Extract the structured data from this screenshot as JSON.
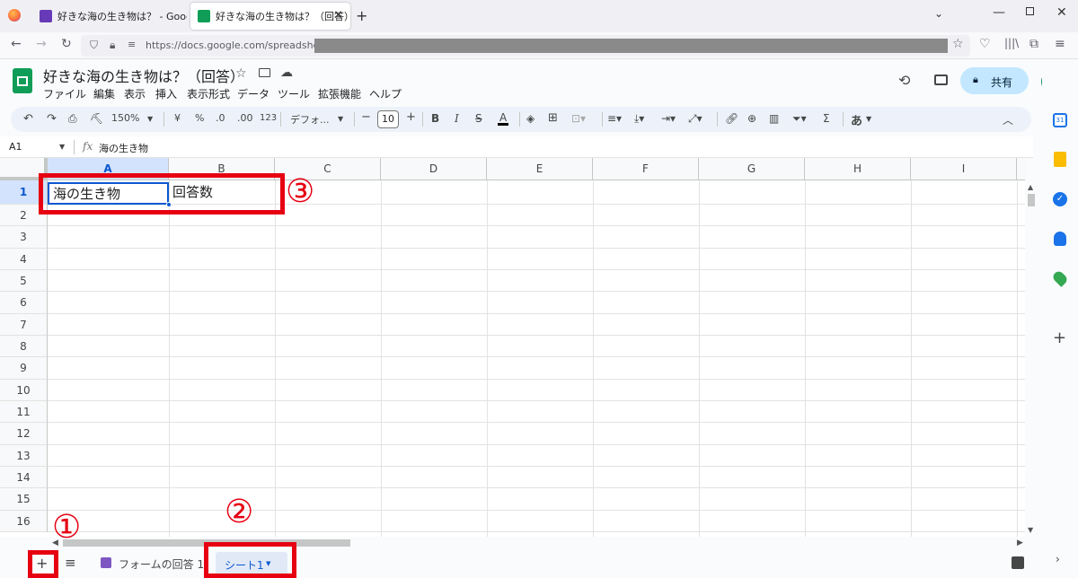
{
  "browser": {
    "tabs": [
      {
        "title": "好きな海の生き物は？ - Google フ",
        "active": false
      },
      {
        "title": "好きな海の生き物は？（回答） - Go",
        "active": true
      }
    ],
    "url_visible": "https://docs.google.com/spreadsheets/"
  },
  "doc": {
    "title": "好きな海の生き物は？（回答）",
    "menu": [
      "ファイル",
      "編集",
      "表示",
      "挿入",
      "表示形式",
      "データ",
      "ツール",
      "拡張機能",
      "ヘルプ"
    ],
    "share_label": "共有"
  },
  "toolbar": {
    "zoom": "150%",
    "currency": "¥",
    "percent": "%",
    "dec_decrease": ".0",
    "dec_increase": ".00",
    "format_123": "123",
    "font": "デフォ...",
    "font_size": "10",
    "bold": "B",
    "italic": "I",
    "text_color": "A",
    "input_tool": "あ"
  },
  "formula_bar": {
    "cell_ref": "A1",
    "fx": "fx",
    "content": "海の生き物"
  },
  "grid": {
    "columns": [
      "A",
      "B",
      "C",
      "D",
      "E",
      "F",
      "G",
      "H",
      "I"
    ],
    "rows": [
      "1",
      "2",
      "3",
      "4",
      "5",
      "6",
      "7",
      "8",
      "9",
      "10",
      "11",
      "12",
      "13",
      "14",
      "15",
      "16"
    ],
    "cells": {
      "A1": "海の生き物",
      "B1": "回答数"
    }
  },
  "sheets": {
    "tabs": [
      "フォームの回答 1",
      "シート1"
    ],
    "active": "シート1"
  },
  "annotations": {
    "marker1": "①",
    "marker2": "②",
    "marker3": "③",
    "color": "#e60012"
  },
  "colors": {
    "accent": "#0b57d0",
    "share_bg": "#c2e7ff",
    "sheets_green": "#0f9d58",
    "forms_purple": "#673ab7"
  }
}
